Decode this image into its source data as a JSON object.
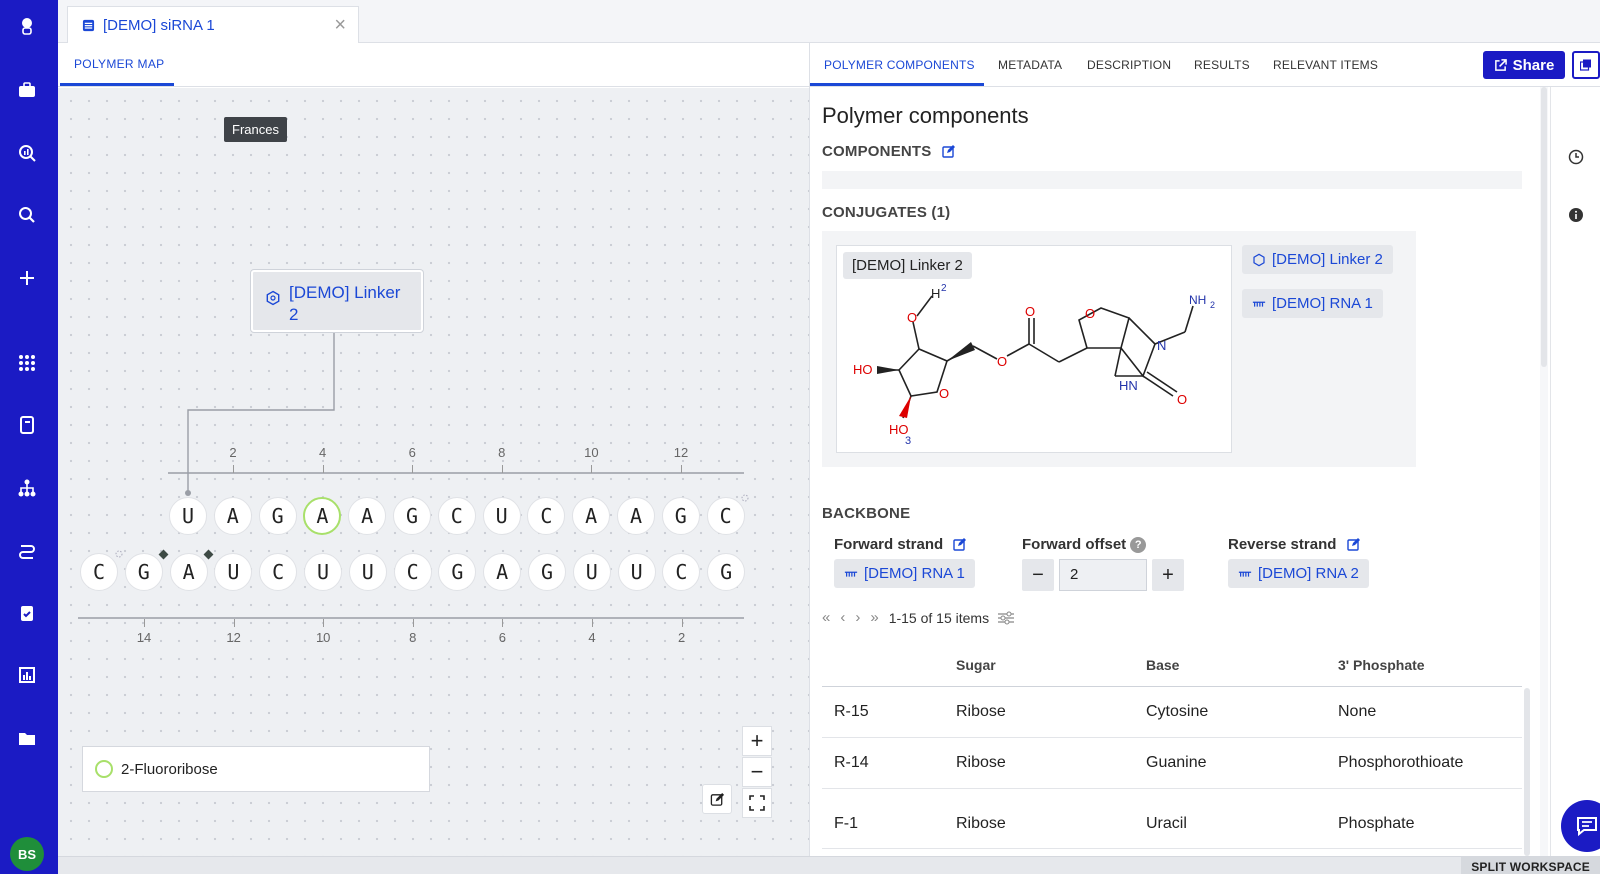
{
  "nav": {
    "avatar_initials": "BS",
    "brand_color": "#1b1bc4"
  },
  "tab": {
    "title": "[DEMO] siRNA 1"
  },
  "map": {
    "tab_label": "POLYMER MAP",
    "tooltip": "Frances",
    "linker_label": "[DEMO] Linker 2",
    "forward_seq": [
      "U",
      "A",
      "G",
      "A",
      "A",
      "G",
      "C",
      "U",
      "C",
      "A",
      "A",
      "G",
      "C"
    ],
    "forward_modified_index": 3,
    "reverse_seq": [
      "C",
      "G",
      "A",
      "U",
      "C",
      "U",
      "U",
      "C",
      "G",
      "A",
      "G",
      "U",
      "U",
      "C",
      "G"
    ],
    "top_ticks": [
      "2",
      "4",
      "6",
      "8",
      "10",
      "12"
    ],
    "bottom_ticks": [
      "14",
      "12",
      "10",
      "8",
      "6",
      "4",
      "2"
    ],
    "legend": "2-Fluororibose",
    "zoom_in": "+",
    "zoom_out": "−"
  },
  "tabs": [
    "POLYMER COMPONENTS",
    "METADATA",
    "DESCRIPTION",
    "RESULTS",
    "RELEVANT ITEMS"
  ],
  "share_label": "Share",
  "panel": {
    "title": "Polymer components",
    "components_label": "COMPONENTS",
    "conjugates_label": "CONJUGATES (1)",
    "structure_label": "[DEMO] Linker 2",
    "chip_linker": "[DEMO] Linker 2",
    "chip_rna1": "[DEMO] RNA 1",
    "backbone_label": "BACKBONE",
    "forward_strand_label": "Forward strand",
    "forward_strand_value": "[DEMO] RNA 1",
    "forward_offset_label": "Forward offset",
    "forward_offset_value": "2",
    "reverse_strand_label": "Reverse strand",
    "reverse_strand_value": "[DEMO] RNA 2",
    "pager_text": "1-15 of 15 items"
  },
  "table": {
    "headers": [
      "Sugar",
      "Base",
      "3' Phosphate"
    ],
    "rows": [
      {
        "id": "R-15",
        "sugar": "Ribose",
        "base": "Cytosine",
        "phosphate": "None"
      },
      {
        "id": "R-14",
        "sugar": "Ribose",
        "base": "Guanine",
        "phosphate": "Phosphorothioate"
      },
      {
        "id": "F-1",
        "sugar": "Ribose",
        "base": "Uracil",
        "phosphate": "Phosphate"
      }
    ]
  },
  "molecule": {
    "atoms": [
      "H",
      "2",
      "O",
      "HO",
      "O",
      "HO",
      "3",
      "O",
      "O",
      "O",
      "N",
      "NH",
      "2",
      "HN",
      "O"
    ]
  },
  "bottom": {
    "split_workspace": "SPLIT WORKSPACE"
  }
}
